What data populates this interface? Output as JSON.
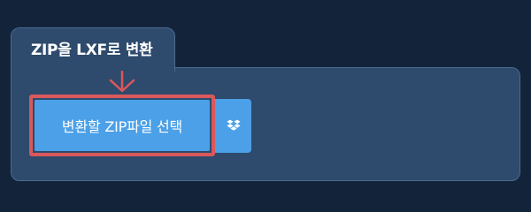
{
  "tab": {
    "title": "ZIP을 LXF로 변환"
  },
  "upload": {
    "select_label": "변환할 ZIP파일 선택",
    "alt_source_icon": "dropbox-icon"
  },
  "colors": {
    "page_background": "#13243a",
    "panel_background": "#2e4a6c",
    "panel_border": "#4b6a90",
    "button_blue": "#4ba0e7",
    "highlight_red": "#d9585b"
  }
}
